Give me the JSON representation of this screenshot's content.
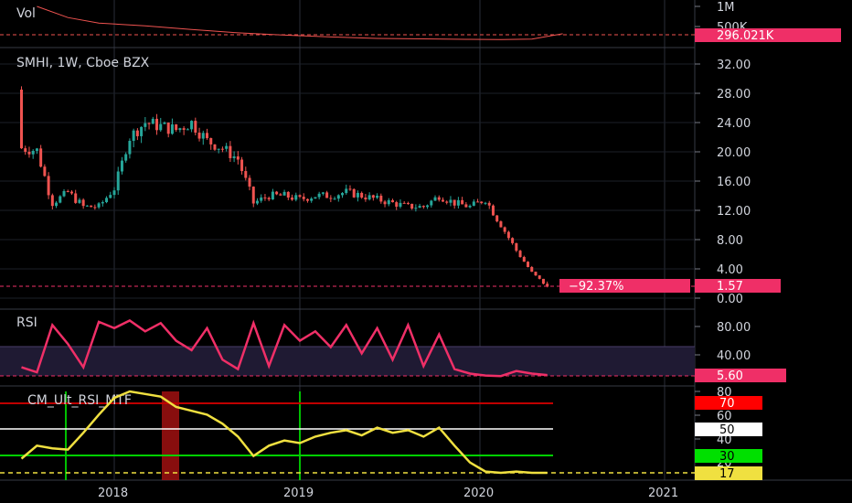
{
  "colors": {
    "background": "#000000",
    "grid": "#2a2e39",
    "axis_text": "#d1d4dc",
    "up_candle": "#26a69a",
    "down_candle": "#ef5350",
    "volume_line": "#ef5350",
    "price_tag": "#ef2f67",
    "rsi_line": "#ef2f67",
    "rsi_band": "#1f1a33",
    "cm_line": "#f0e040",
    "cm_level_70": "#c00000",
    "cm_level_50": "#ffffff",
    "cm_level_30": "#00d000",
    "cm_level_17": "#f0e040",
    "signal_green": "#00c000",
    "signal_red": "#a01010"
  },
  "panes": {
    "volume": {
      "title": "Vol",
      "last_label": "296.021K"
    },
    "price": {
      "title": "SMHI, 1W, Cboe BZX",
      "last_label": "1.57",
      "change_label": "−92.37%"
    },
    "rsi": {
      "title": "RSI",
      "last_label": "5.60"
    },
    "cm": {
      "title": "CM_Ult_RSI_MTF"
    }
  },
  "chart_data": [
    {
      "type": "line",
      "title": "Vol",
      "yticks": [
        "1M",
        "500K"
      ],
      "last_value": "296.021K",
      "x_dates": [
        "2017-08",
        "2017-10",
        "2017-12",
        "2018-03",
        "2018-06",
        "2018-09",
        "2018-12",
        "2019-03",
        "2019-06",
        "2019-09",
        "2019-12",
        "2020-02",
        "2020-04",
        "2020-06"
      ],
      "values": [
        1000000,
        760000,
        640000,
        580000,
        500000,
        430000,
        380000,
        340000,
        310000,
        300000,
        290000,
        285000,
        295000,
        410000
      ]
    },
    {
      "type": "candlestick",
      "title": "SMHI, 1W, Cboe BZX",
      "yticks": [
        "32.00",
        "28.00",
        "24.00",
        "20.00",
        "16.00",
        "12.00",
        "8.00",
        "4.00",
        "0.00"
      ],
      "ylim": [
        0,
        34
      ],
      "xticks": [
        "2018",
        "2019",
        "2020",
        "2021"
      ],
      "last_value": "1.57",
      "change": "−92.37%",
      "x_dates": [
        "2017-07",
        "2017-08",
        "2017-09",
        "2017-10",
        "2017-11",
        "2017-12",
        "2018-01",
        "2018-02",
        "2018-03",
        "2018-04",
        "2018-05",
        "2018-06",
        "2018-07",
        "2018-08",
        "2018-09",
        "2018-10",
        "2018-11",
        "2018-12",
        "2019-01",
        "2019-02",
        "2019-03",
        "2019-04",
        "2019-05",
        "2019-06",
        "2019-07",
        "2019-08",
        "2019-09",
        "2019-10",
        "2019-11",
        "2019-12",
        "2020-01",
        "2020-02",
        "2020-03",
        "2020-04",
        "2020-05"
      ],
      "close": [
        20.5,
        20.2,
        13.0,
        14.5,
        12.5,
        12.5,
        15.0,
        22.0,
        24.0,
        23.5,
        23.0,
        24.0,
        21.5,
        20.5,
        19.0,
        13.0,
        14.0,
        14.0,
        13.5,
        14.0,
        14.0,
        14.5,
        14.0,
        13.5,
        13.0,
        12.5,
        12.5,
        14.0,
        13.0,
        12.5,
        13.5,
        10.0,
        6.5,
        3.5,
        1.57
      ]
    },
    {
      "type": "line",
      "title": "RSI",
      "yticks": [
        "80.00",
        "40.00"
      ],
      "last_value": "5.60",
      "values": [
        18,
        10,
        85,
        55,
        18,
        90,
        80,
        92,
        75,
        88,
        60,
        45,
        80,
        30,
        15,
        88,
        20,
        85,
        60,
        75,
        50,
        85,
        40,
        80,
        30,
        85,
        20,
        70,
        15,
        8,
        5,
        4,
        12,
        8,
        5.6
      ]
    },
    {
      "type": "line",
      "title": "CM_Ult_RSI_MTF",
      "yticks": [
        "80",
        "60",
        "40",
        "20"
      ],
      "levels": [
        "70",
        "50",
        "30",
        "17"
      ],
      "values": [
        28,
        38,
        36,
        35,
        48,
        62,
        75,
        80,
        78,
        76,
        68,
        65,
        62,
        55,
        45,
        30,
        38,
        42,
        40,
        45,
        48,
        50,
        46,
        52,
        48,
        50,
        45,
        52,
        38,
        25,
        18,
        17,
        18,
        17,
        17
      ]
    }
  ]
}
